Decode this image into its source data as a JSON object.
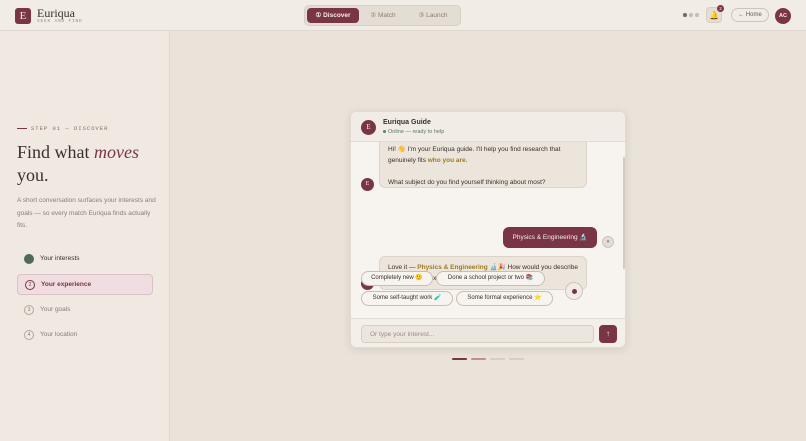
{
  "app": {
    "logo_letter": "E",
    "name": "Euriqua",
    "tagline": "SEEK AND FIND"
  },
  "nav": {
    "steps": [
      {
        "label": "① Discover",
        "active": true
      },
      {
        "label": "② Match",
        "active": false
      },
      {
        "label": "③ Launch",
        "active": false
      }
    ],
    "notifications_count": "2",
    "bell_icon": "🔔",
    "home_label": "← Home",
    "avatar_initials": "AC"
  },
  "left": {
    "eyebrow": "STEP 01 — DISCOVER",
    "headline_pre": "Find what ",
    "headline_em": "moves",
    "headline_post": "you.",
    "description": "A short conversation surfaces your interests and goals — so every match Euriqua finds actually fits.",
    "steps": [
      {
        "num": "",
        "label": "Your interests",
        "state": "done"
      },
      {
        "num": "2",
        "label": "Your experience",
        "state": "active"
      },
      {
        "num": "3",
        "label": "Your goals",
        "state": "todo"
      },
      {
        "num": "4",
        "label": "Your location",
        "state": "todo"
      }
    ]
  },
  "chat": {
    "guide_letter": "E",
    "guide_name": "Euriqua Guide",
    "status": "Online — ready to help",
    "msg1_a": "Hi! 👋 I'm your Euriqua guide. I'll help you find research that genuinely fits ",
    "msg1_b": "who you are",
    "msg1_c": ".",
    "msg1_q": "What subject do you find yourself thinking about most?",
    "user_reply": "Physics & Engineering 🔬",
    "msg2_a": "Love it — ",
    "msg2_b": "Physics & Engineering",
    "msg2_c": " 🔬🎉 How would you describe your research experience so far?",
    "chips": [
      "Completely new 🙂",
      "Done a school project or two 📚",
      "Some self-taught work 🧪",
      "Some formal experience ⭐"
    ],
    "input_placeholder": "Or type your interest...",
    "send_icon": "↑"
  },
  "progress": {
    "segments": 4,
    "current": 1
  },
  "colors": {
    "accent": "#7a3545",
    "background": "#e9e3da",
    "success": "#4d6b56",
    "highlight": "#a07a1e"
  }
}
